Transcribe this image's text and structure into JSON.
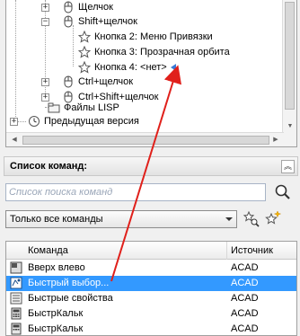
{
  "tree": {
    "items": [
      {
        "label": "Щелчок",
        "expander": "+"
      },
      {
        "label": "Shift+щелчок",
        "expander": "−"
      },
      {
        "label": "Кнопка 2: Меню Привязки"
      },
      {
        "label": "Кнопка 3: Прозрачная орбита"
      },
      {
        "label": "Кнопка 4: <нет>"
      },
      {
        "label": "Ctrl+щелчок",
        "expander": "+"
      },
      {
        "label": "Ctrl+Shift+щелчок",
        "expander": "+"
      },
      {
        "label": "Файлы LISP"
      },
      {
        "label": "Предыдущая версия",
        "expander": "+"
      }
    ]
  },
  "command_panel": {
    "title": "Список команд:",
    "search_placeholder": "Список поиска команд",
    "filter_value": "Только все команды",
    "columns": {
      "command": "Команда",
      "source": "Источник"
    },
    "rows": [
      {
        "name": "Вверх влево",
        "source": "ACAD",
        "selected": false,
        "icon": "move-up-left-icon"
      },
      {
        "name": "Быстрый выбор...",
        "source": "ACAD",
        "selected": true,
        "icon": "quick-select-icon"
      },
      {
        "name": "Быстрые свойства",
        "source": "ACAD",
        "selected": false,
        "icon": "quick-properties-icon"
      },
      {
        "name": "БыстрКальк",
        "source": "ACAD",
        "selected": false,
        "icon": "calculator-icon"
      },
      {
        "name": "БыстрКальк",
        "source": "ACAD",
        "selected": false,
        "icon": "calculator-icon"
      }
    ]
  },
  "colors": {
    "selection": "#3399ff",
    "annotation_arrow": "#e0201b",
    "tree_selected_arrow": "#3a7ad6"
  }
}
